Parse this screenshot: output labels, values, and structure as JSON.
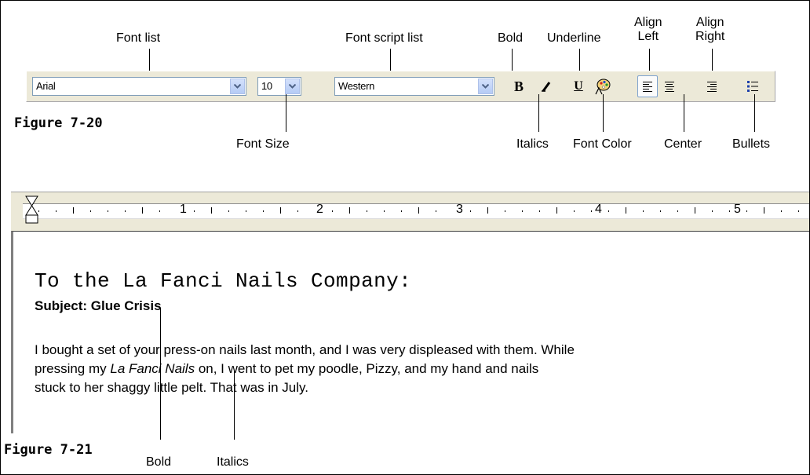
{
  "callouts": {
    "font_list": "Font list",
    "font_script_list": "Font script list",
    "bold": "Bold",
    "underline": "Underline",
    "align_left": [
      "Align",
      "Left"
    ],
    "align_right": [
      "Align",
      "Right"
    ],
    "font_size": "Font Size",
    "italics": "Italics",
    "font_color": "Font Color",
    "center": "Center",
    "bullets": "Bullets",
    "bold_2": "Bold",
    "italics_2": "Italics"
  },
  "figures": {
    "fig1": "Figure 7-20",
    "fig2": "Figure 7-21"
  },
  "toolbar": {
    "font_value": "Arial",
    "size_value": "10",
    "script_value": "Western",
    "bold_label": "B",
    "underline_label": "U",
    "active_alignment": "align-left",
    "accent": "#7da2ce"
  },
  "ruler": {
    "numbers": [
      "1",
      "2",
      "3",
      "4",
      "5"
    ]
  },
  "document": {
    "heading": "To the La Fanci Nails Company:",
    "subject": "Subject: Glue Crisis",
    "line1": "I bought a set of your press-on nails last month, and I was very displeased with them. While",
    "line2_a": "pressing my ",
    "line2_italic": "La Fanci Nails",
    "line2_b": " on, I went to pet my poodle, Pizzy, and my hand and nails",
    "line3": "stuck to her shaggy little pelt. That was in July."
  }
}
